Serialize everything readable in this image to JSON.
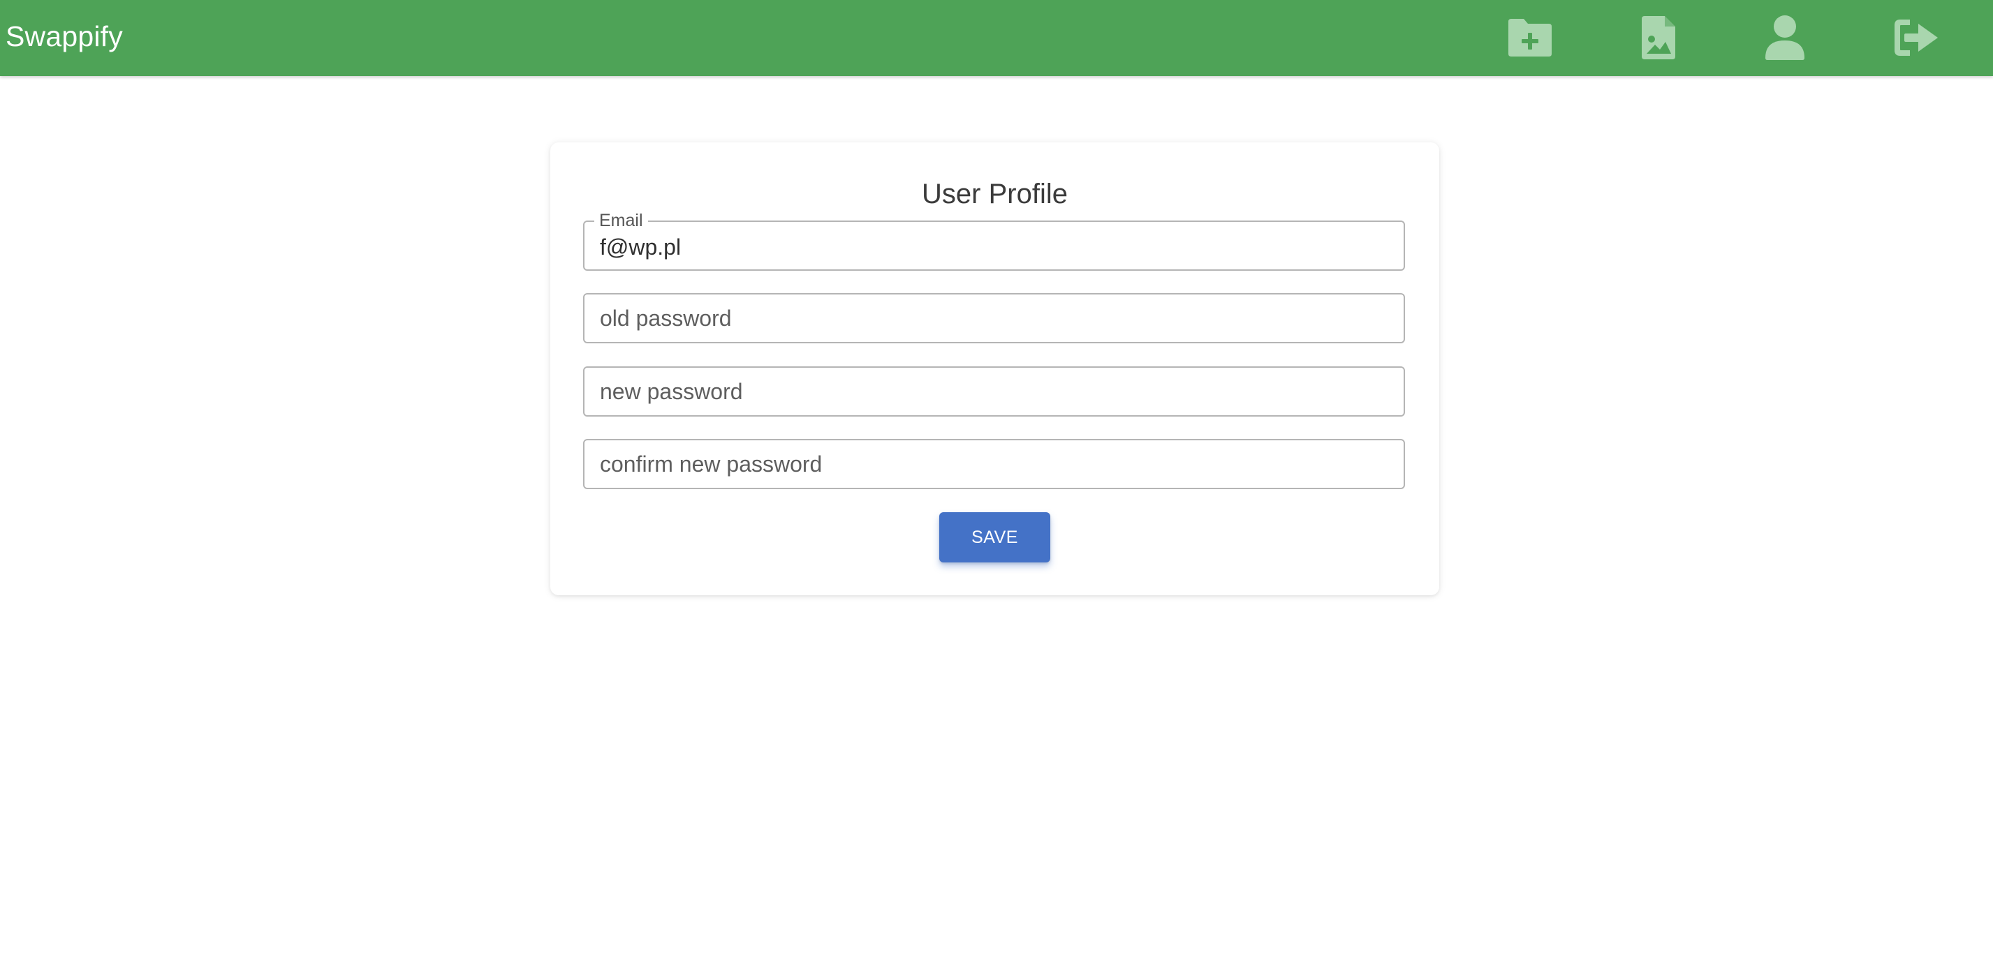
{
  "header": {
    "brand": "Swappify",
    "background_color": "#4ea357",
    "icon_color": "#a9d6ae",
    "actions": [
      {
        "id": "add-folder",
        "icon": "folder-plus-icon"
      },
      {
        "id": "images",
        "icon": "file-image-icon"
      },
      {
        "id": "profile",
        "icon": "user-icon"
      },
      {
        "id": "logout",
        "icon": "sign-out-icon"
      }
    ]
  },
  "profile_form": {
    "title": "User Profile",
    "email": {
      "label": "Email",
      "value": "f@wp.pl"
    },
    "old_password": {
      "placeholder": "old password",
      "value": ""
    },
    "new_password": {
      "placeholder": "new password",
      "value": ""
    },
    "confirm_password": {
      "placeholder": "confirm new password",
      "value": ""
    },
    "save_label": "SAVE",
    "save_color": "#4472c7"
  }
}
